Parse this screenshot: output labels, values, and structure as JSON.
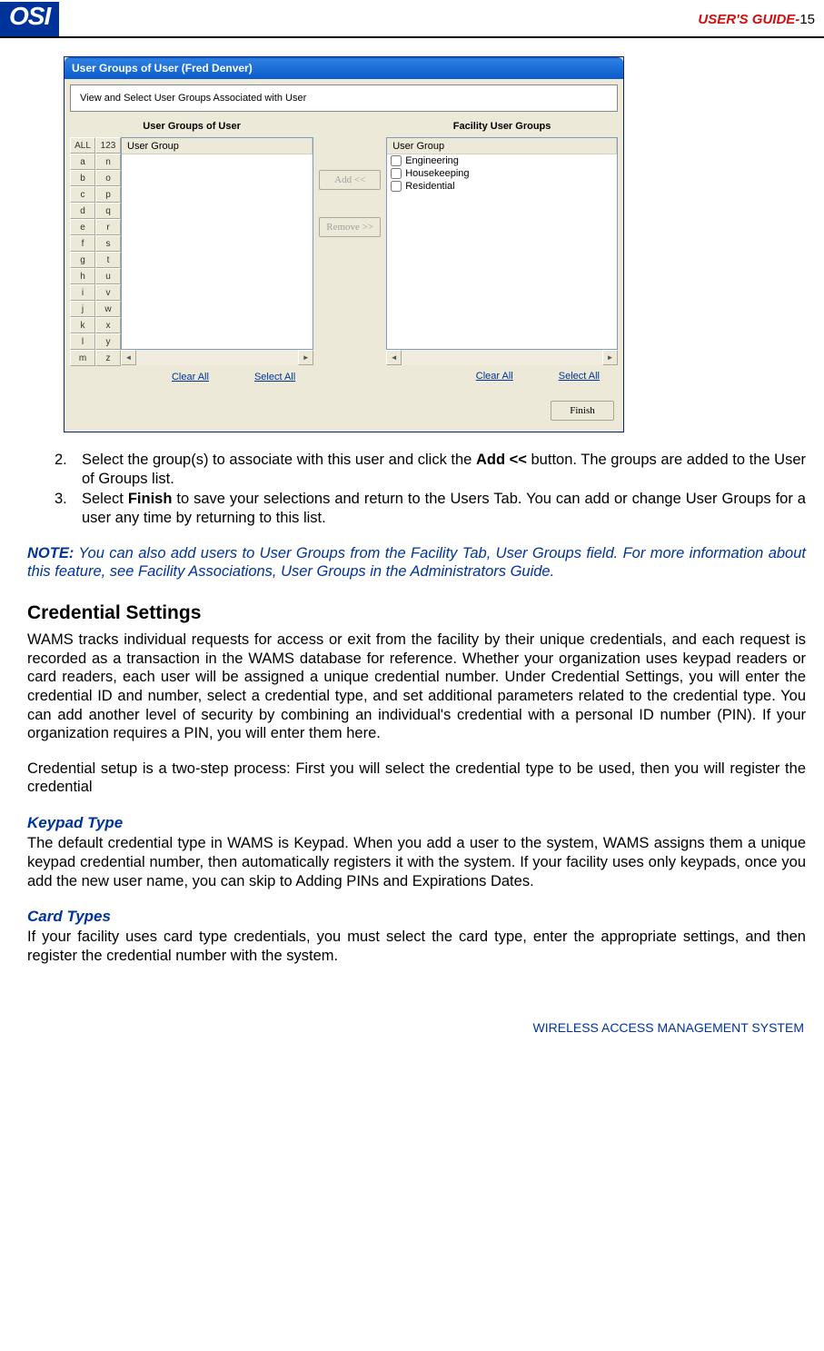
{
  "header": {
    "logo": "OSI",
    "guide_label": "USER'S GUIDE-",
    "page_num": "15"
  },
  "window": {
    "title": "User Groups of User (Fred Denver)",
    "instruction": "View and Select User Groups Associated with User",
    "left_section": "User Groups of User",
    "right_section": "Facility User Groups",
    "col_header": "User Group",
    "alpha": {
      "all": "ALL",
      "num": "123",
      "cells": [
        "a",
        "n",
        "b",
        "o",
        "c",
        "p",
        "d",
        "q",
        "e",
        "r",
        "f",
        "s",
        "g",
        "t",
        "h",
        "u",
        "i",
        "v",
        "j",
        "w",
        "k",
        "x",
        "l",
        "y",
        "m",
        "z"
      ]
    },
    "facility_items": [
      "Engineering",
      "Housekeeping",
      "Residential"
    ],
    "btn_add": "Add     <<",
    "btn_remove": "Remove >>",
    "link_clear": "Clear All",
    "link_select": "Select All",
    "btn_finish": "Finish"
  },
  "doc": {
    "step2": "Select the group(s) to associate with this user and click the ",
    "step2_bold": "Add <<",
    "step2_end": " button. The groups are added to the   User of Groups list.",
    "step3a": "Select ",
    "step3_bold": "Finish",
    "step3b": " to save your selections and return to the Users Tab. You can add or change User Groups for a user any time by returning to this list.",
    "note_label": "NOTE:",
    "note_text": "   You can also add users to User Groups from the Facility Tab, User Groups field.   For more information about this feature, see Facility Associations, User Groups in the Administrators Guide.",
    "h2": "Credential Settings",
    "p1": "WAMS tracks individual requests for access or exit from the facility by their unique credentials, and each request is recorded as a transaction in the WAMS database for reference.   Whether your organization uses keypad readers or card readers, each user will be assigned a unique credential number.   Under Credential Settings, you will enter the credential ID and number, select a credential type, and set additional parameters related to the credential type.   You can add another level of security by combining an individual's credential with a personal ID number (PIN). If your organization requires a PIN, you will enter them here.",
    "p2": "Credential setup is a two-step process:   First you will select the credential type to be used, then you will register the credential",
    "h3a": "Keypad Type",
    "p3": "The default credential type in WAMS is Keypad.   When you add a user to the system, WAMS assigns them a unique keypad credential number, then automatically registers it with the system. If your facility uses only keypads, once you add the new user name, you can skip to Adding PINs and Expirations Dates.",
    "h3b": "Card Types",
    "p4": "If your facility uses card type credentials, you must select the card type, enter the appropriate settings, and then register the credential number with the system."
  },
  "footer": "WIRELESS ACCESS MANAGEMENT SYSTEM"
}
